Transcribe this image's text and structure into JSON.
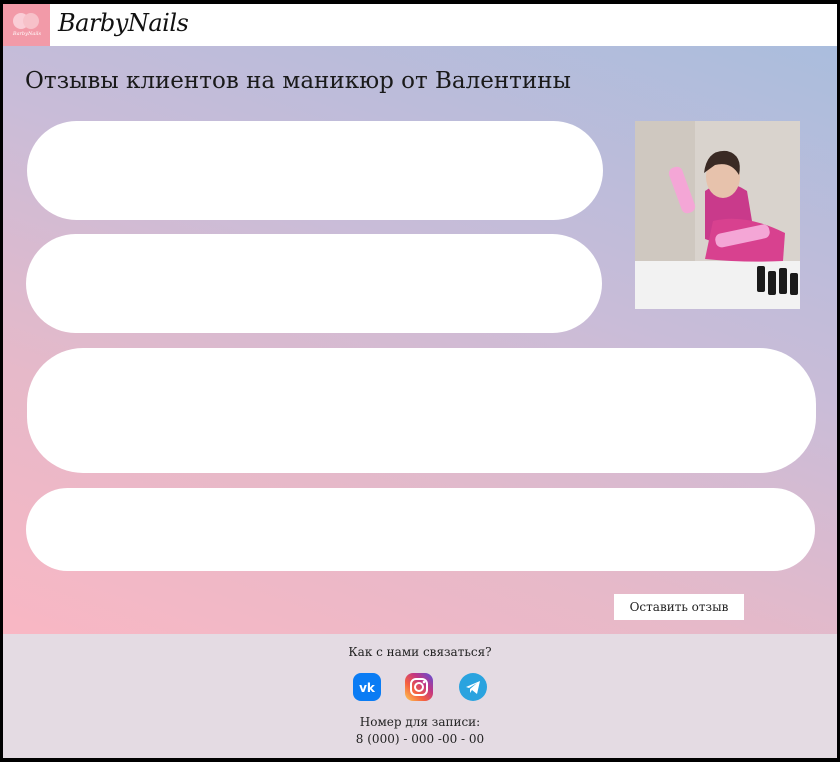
{
  "header": {
    "brand": "BarbyNails",
    "logo_mini_text": "BarbyNails"
  },
  "main": {
    "title": "Отзывы клиентов на маникюр от Валентины",
    "reviews": [
      "",
      "",
      "",
      ""
    ],
    "photo_alt": "Мастер маникюра Валентина",
    "leave_review_label": "Оставить отзыв"
  },
  "footer": {
    "contact_title": "Как с нами связаться?",
    "socials": [
      {
        "name": "vk",
        "icon": "vk-icon"
      },
      {
        "name": "instagram",
        "icon": "instagram-icon"
      },
      {
        "name": "telegram",
        "icon": "telegram-icon"
      }
    ],
    "phone_label": "Номер для записи:",
    "phone": "8 (000) - 000 -00 - 00"
  },
  "colors": {
    "logo_bg": "#f29aa8",
    "gradient_top": "#aabddd",
    "gradient_bottom": "#f9b7c4",
    "footer_bg": "#e4dbe3",
    "vk": "#0a7cf4",
    "telegram": "#2aa3df"
  }
}
